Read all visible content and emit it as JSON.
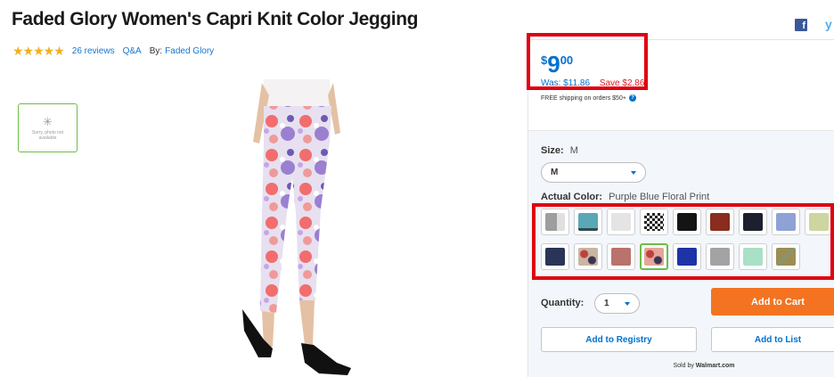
{
  "product": {
    "title": "Faded Glory Women's Capri Knit Color Jegging",
    "stars": "★★★★★",
    "reviews": "26 reviews",
    "qa": "Q&A",
    "by_label": "By:",
    "brand": "Faded Glory",
    "thumbnail_text": "Sorry, photo not available"
  },
  "price": {
    "currency": "$",
    "dollars": "9",
    "cents": "00",
    "was": "Was: $11.86",
    "save": "Save $2.86",
    "shipping": "FREE shipping on orders $50+"
  },
  "options": {
    "size_label": "Size:",
    "size_value": "M",
    "size_select": "M",
    "color_label": "Actual Color:",
    "color_value": "Purple Blue Floral Print",
    "swatches": [
      "#9e9e9e",
      "#5aa7b6",
      "#e4e4e4",
      "#222222",
      "#141414",
      "#8a2c1e",
      "#1b1f2e",
      "#8ea2d6",
      "#cdd6a0",
      "#293457",
      "#c9b6a2",
      "#b9726c",
      "#e3a79a",
      "#1c34a6",
      "#a3a3a3",
      "#a9e0c7",
      "#9c8d55"
    ]
  },
  "purchase": {
    "quantity_label": "Quantity:",
    "quantity_value": "1",
    "add_to_cart": "Add to Cart",
    "add_to_registry": "Add to Registry",
    "add_to_list": "Add to List",
    "sold_by_prefix": "Sold by",
    "sold_by": "Walmart.com"
  },
  "colors": {
    "accent_blue": "#0071ce",
    "cart_orange": "#f47321",
    "save_red": "#de1c24",
    "highlight_red": "#e0000f",
    "star_gold": "#f2b01e",
    "selected_green": "#6cbd45"
  }
}
